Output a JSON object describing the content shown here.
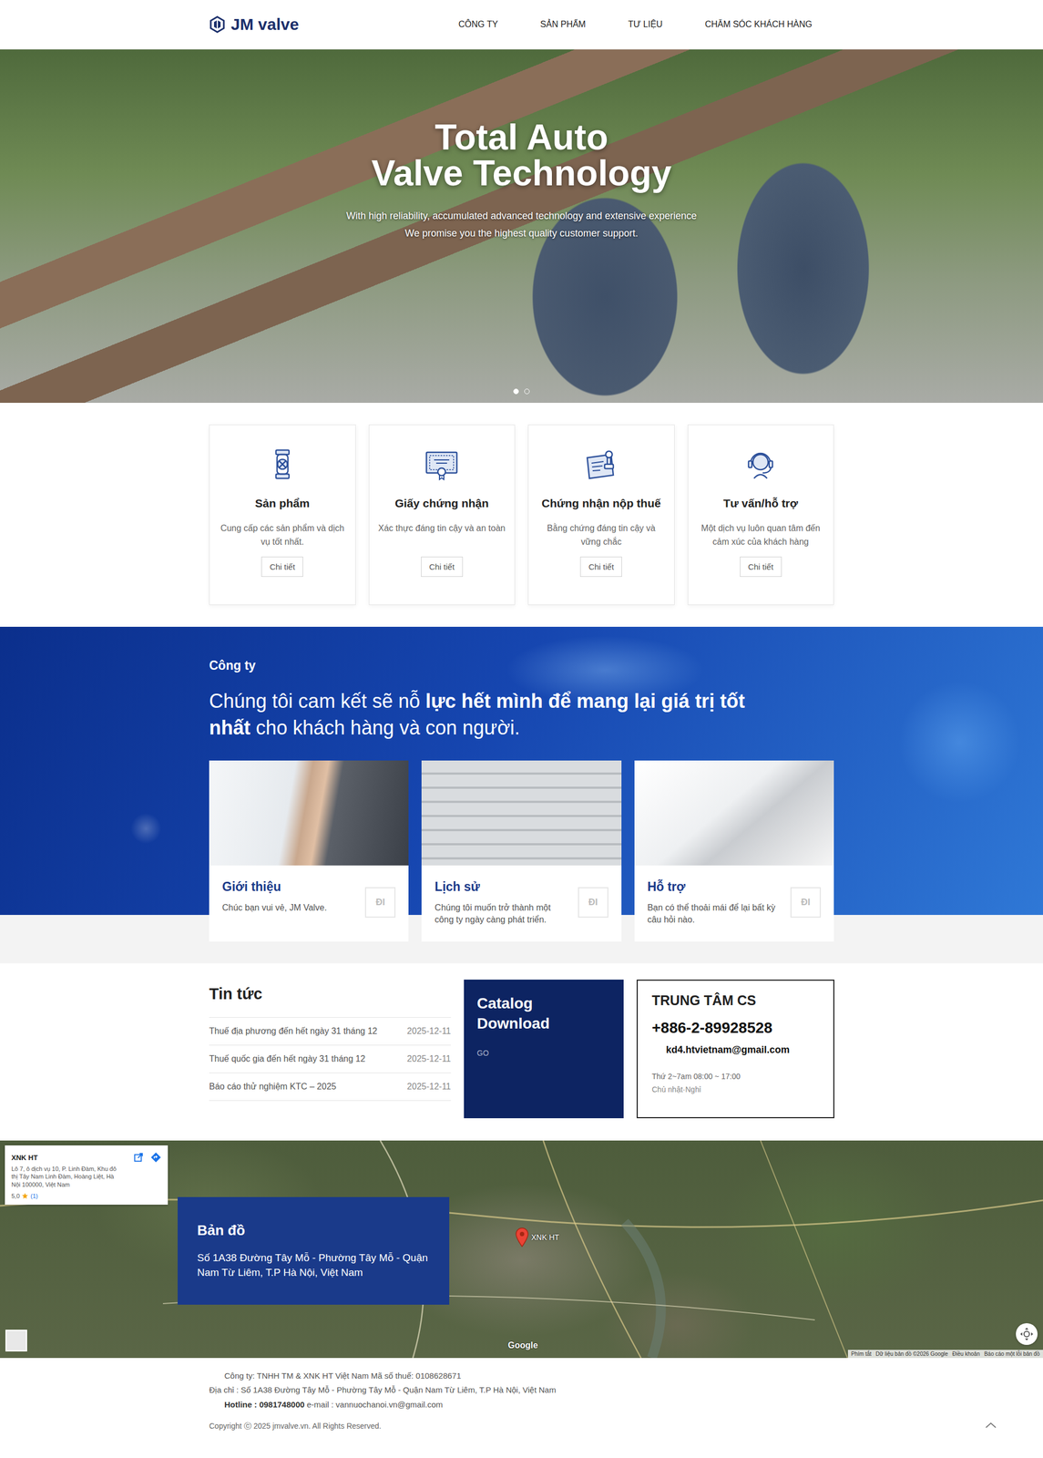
{
  "header": {
    "logo": "JM valve",
    "nav": [
      "CÔNG TY",
      "SẢN PHẨM",
      "TƯ LIỆU",
      "CHĂM SÓC KHÁCH HÀNG"
    ]
  },
  "hero": {
    "title": [
      "Total Auto",
      "Valve Technology"
    ],
    "subtitle": [
      "With high reliability, accumulated advanced technology and extensive experience",
      "We promise you the highest quality customer support."
    ],
    "slides": [
      {
        "selected": true
      },
      {
        "selected": false
      }
    ]
  },
  "features": [
    {
      "kind": "product",
      "title": "Sản phẩm",
      "desc": "Cung cấp các sản phẩm và dịch vụ tốt nhất.",
      "button": "Chi tiết"
    },
    {
      "kind": "certificate",
      "title": "Giấy chứng nhận",
      "desc": "Xác thực đáng tin cậy và an toàn",
      "button": "Chi tiết"
    },
    {
      "kind": "tax",
      "title": "Chứng nhận nộp thuế",
      "desc": "Bằng chứng đáng tin cậy và vững chắc",
      "button": "Chi tiết"
    },
    {
      "kind": "support",
      "title": "Tư vấn/hỗ trợ",
      "desc": "Một dịch vụ luôn quan tâm đến cảm xúc của khách hàng",
      "button": "Chi tiết"
    }
  ],
  "company": {
    "label": "Công ty",
    "heading": [
      {
        "text": "Chúng tôi cam kết sẽ nỗ ",
        "bold": false
      },
      {
        "text": "lực hết mình để mang lại giá trị tốt nhất",
        "bold": true
      },
      {
        "text": " cho khách hàng và con người.",
        "bold": false
      }
    ],
    "cards": [
      {
        "kind": "handshake",
        "title": "Giới thiệu",
        "desc": "Chúc bạn vui vẻ, JM Valve.",
        "button": "ĐI"
      },
      {
        "kind": "stairs",
        "title": "Lịch sử",
        "desc": "Chúng tôi muốn trở thành một công ty ngày càng phát triển.",
        "button": "ĐI"
      },
      {
        "kind": "laptop",
        "title": "Hỗ trợ",
        "desc": "Bạn có thể thoải mái để lại bất kỳ câu hỏi nào.",
        "button": "ĐI"
      }
    ]
  },
  "news": {
    "title": "Tin tức",
    "items": [
      {
        "title": "Thuế địa phương đến hết ngày 31 tháng 12",
        "date": "2025-12-11"
      },
      {
        "title": "Thuế quốc gia đến hết ngày 31 tháng 12",
        "date": "2025-12-11"
      },
      {
        "title": "Báo cáo thử nghiệm KTC – 2025",
        "date": "2025-12-11"
      }
    ]
  },
  "catalog": {
    "title": "Catalog Download",
    "link": "GO"
  },
  "cs": {
    "title": "TRUNG TÂM CS",
    "phone": "+886-2-89928528",
    "email": "kd4.htvietnam@gmail.com",
    "hours": "Thứ 2~7am 08:00 ~ 17:00",
    "closed": "Chủ nhật·Nghỉ"
  },
  "map": {
    "place": {
      "name": "XNK HT",
      "address": "Lô 7, ô dịch vụ 10, P. Linh Đàm, Khu đô thị Tây Nam Linh Đàm, Hoàng Liệt, Hà Nội 100000, Việt Nam",
      "rating": "5,0",
      "stars": 1,
      "count": "(1)"
    },
    "pin": "XNK HT",
    "panelTitle": "Bản đồ",
    "address": "Số 1A38 Đường Tây Mỗ - Phường Tây Mỗ - Quận Nam Từ Liêm, T.P Hà Nội, Việt Nam",
    "google": "Google",
    "attribution": [
      "Phím tắt",
      "Dữ liệu bản đồ ©2026 Google",
      "Điều khoản",
      "Báo cáo một lỗi bản đồ"
    ]
  },
  "footer": {
    "lines": [
      [
        {
          "text": "Công ty: TNHH TM & XNK HT Việt Nam  Mã số thuế: 0108628671",
          "bold": false
        }
      ],
      [
        {
          "text": "Địa chỉ : Số 1A38 Đường Tây Mỗ - Phường Tây Mỗ - Quận Nam Từ Liêm, T.P Hà Nội, Việt Nam",
          "bold": false
        }
      ],
      [
        {
          "text": "Hotline : 0981748000",
          "bold": true
        },
        {
          "text": " e-mail : vannuochanoi.vn@gmail.com",
          "bold": false
        }
      ]
    ],
    "copyright": "Copyright ⓒ 2025 jmvalve.vn. All Rights Reserved."
  }
}
